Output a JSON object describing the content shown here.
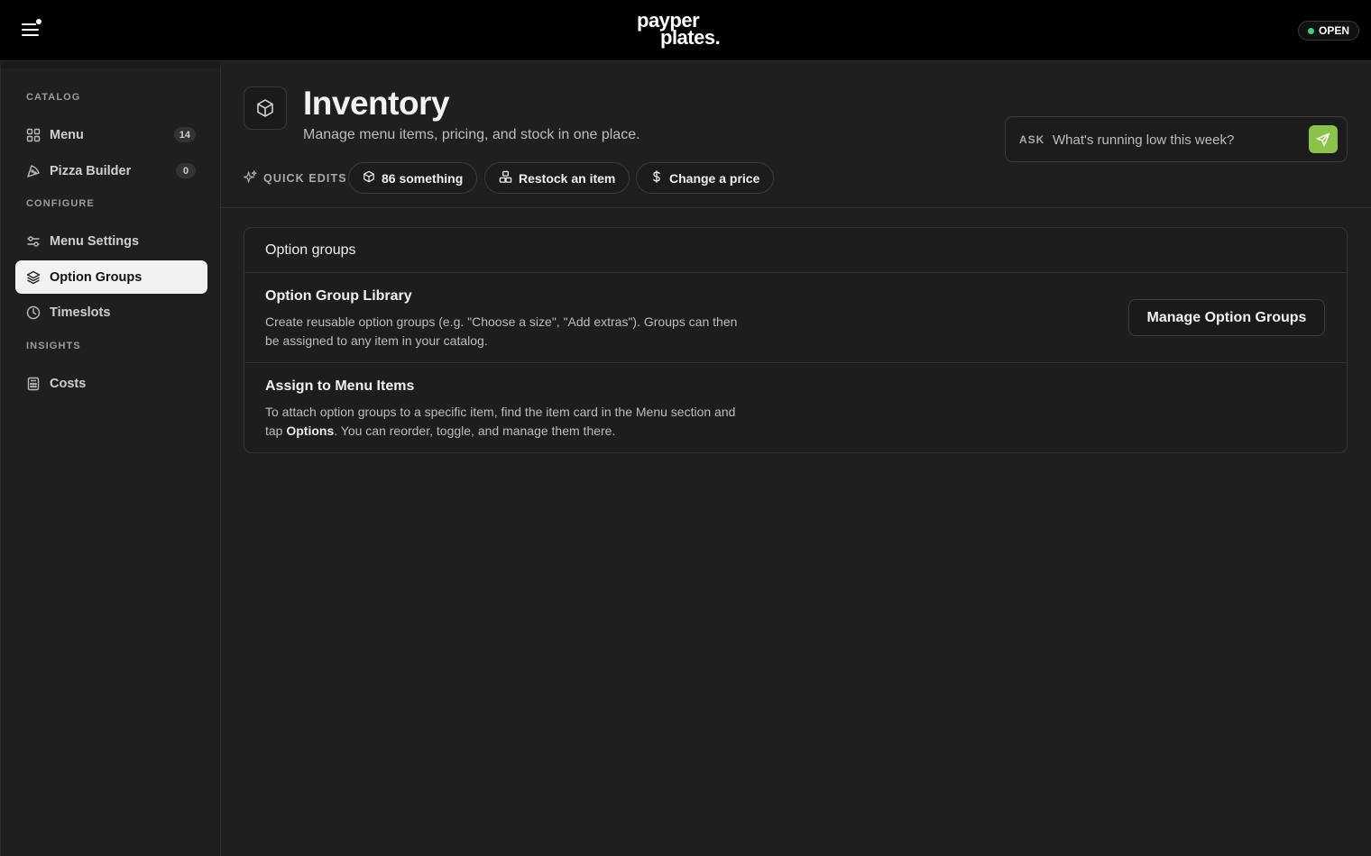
{
  "header": {
    "logo_line1": "payper",
    "logo_line2": "plates.",
    "status": "OPEN",
    "status_color": "#4cd163"
  },
  "sidebar": {
    "sections": [
      {
        "label": "CATALOG"
      },
      {
        "label": "CONFIGURE"
      },
      {
        "label": "INSIGHTS"
      }
    ],
    "items": [
      {
        "label": "Menu",
        "icon": "grid-icon",
        "count": "14"
      },
      {
        "label": "Pizza Builder",
        "icon": "pizza-icon",
        "count": "0"
      },
      {
        "label": "Menu Settings",
        "icon": "sliders-icon"
      },
      {
        "label": "Option Groups",
        "icon": "layers-icon",
        "active": true
      },
      {
        "label": "Timeslots",
        "icon": "clock-icon"
      },
      {
        "label": "Costs",
        "icon": "calculator-icon"
      }
    ]
  },
  "page": {
    "title": "Inventory",
    "subtitle": "Manage menu items, pricing, and stock in one place.",
    "icon": "box-icon"
  },
  "ask": {
    "label": "ASK",
    "placeholder": "What's running low this week?",
    "send_color": "#8bc34a"
  },
  "quick_edits": {
    "label": "QUICK EDITS",
    "chips": [
      {
        "label": "86 something",
        "icon": "box-icon"
      },
      {
        "label": "Restock an item",
        "icon": "stack-icon"
      },
      {
        "label": "Change a price",
        "icon": "dollar-icon"
      }
    ]
  },
  "card": {
    "header": "Option groups",
    "rows": [
      {
        "title": "Option Group Library",
        "desc": "Create reusable option groups (e.g. \"Choose a size\", \"Add extras\"). Groups can then be assigned to any item in your catalog.",
        "button": "Manage Option Groups"
      },
      {
        "title": "Assign to Menu Items",
        "desc_before": "To attach option groups to a specific item, find the item card in the Menu section and tap ",
        "desc_bold": "Options",
        "desc_after": ". You can reorder, toggle, and manage them there."
      }
    ]
  }
}
